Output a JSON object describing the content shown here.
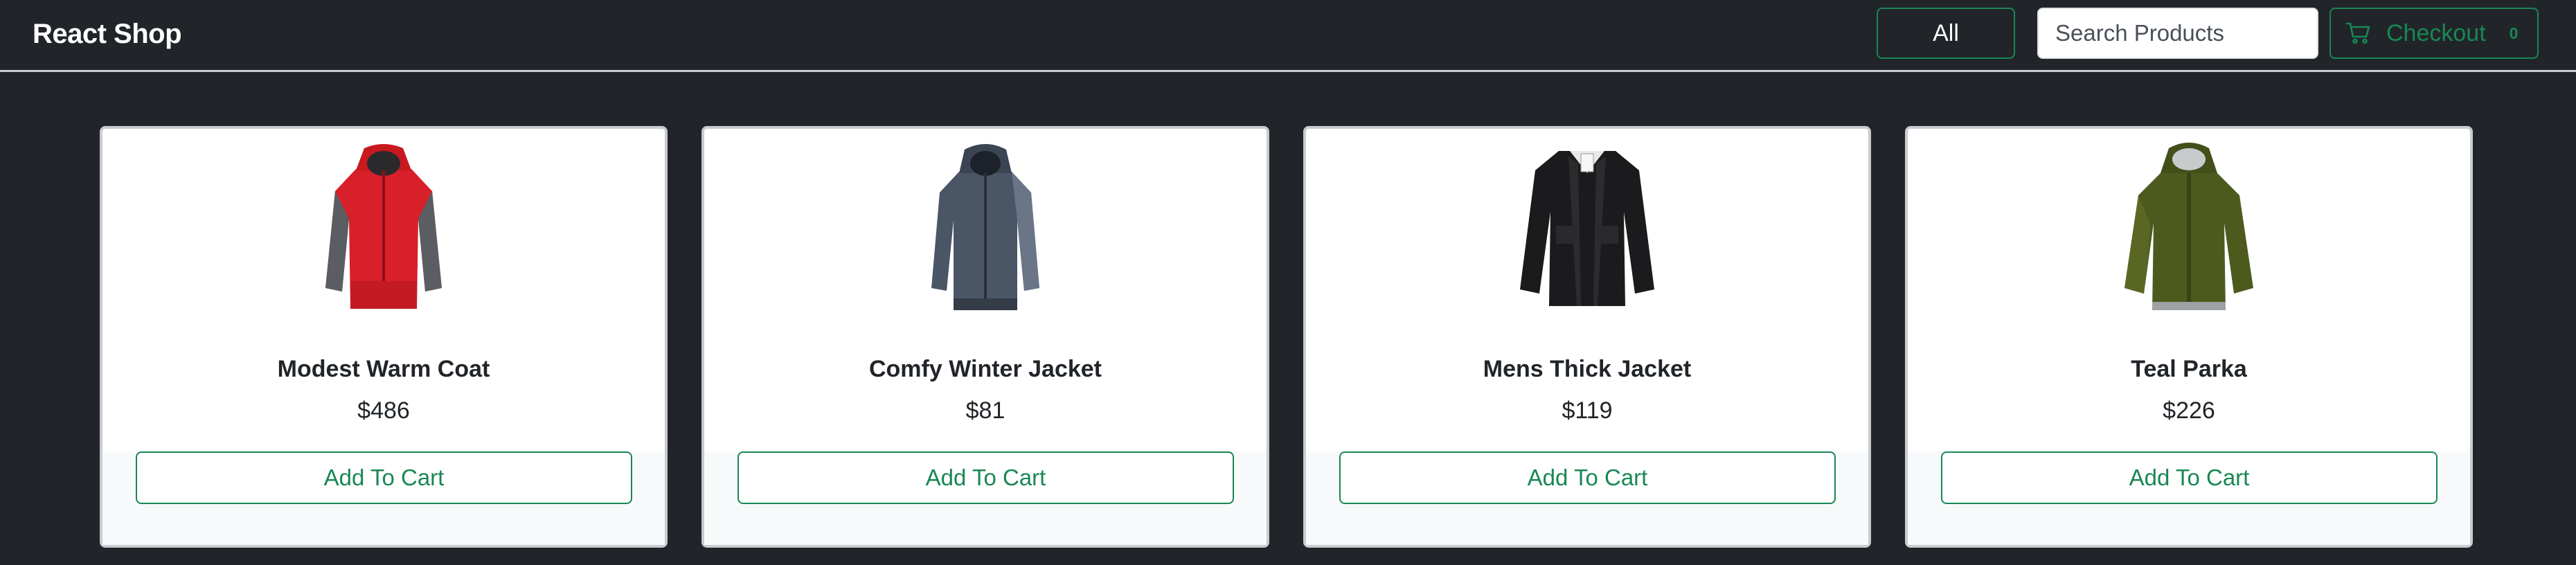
{
  "navbar": {
    "brand": "React Shop",
    "category_button_label": "All",
    "search_placeholder": "Search Products",
    "checkout_label": "Checkout",
    "cart_count": "0"
  },
  "colors": {
    "background": "#212529",
    "accent_green": "#198754",
    "card_bg": "#ffffff"
  },
  "products": [
    {
      "title": "Modest Warm Coat",
      "price": "$486",
      "button_label": "Add To Cart",
      "image_icon": "red-coat-image"
    },
    {
      "title": "Comfy Winter Jacket",
      "price": "$81",
      "button_label": "Add To Cart",
      "image_icon": "navy-jacket-image"
    },
    {
      "title": "Mens Thick Jacket",
      "price": "$119",
      "button_label": "Add To Cart",
      "image_icon": "black-jacket-image"
    },
    {
      "title": "Teal Parka",
      "price": "$226",
      "button_label": "Add To Cart",
      "image_icon": "olive-parka-image"
    }
  ]
}
